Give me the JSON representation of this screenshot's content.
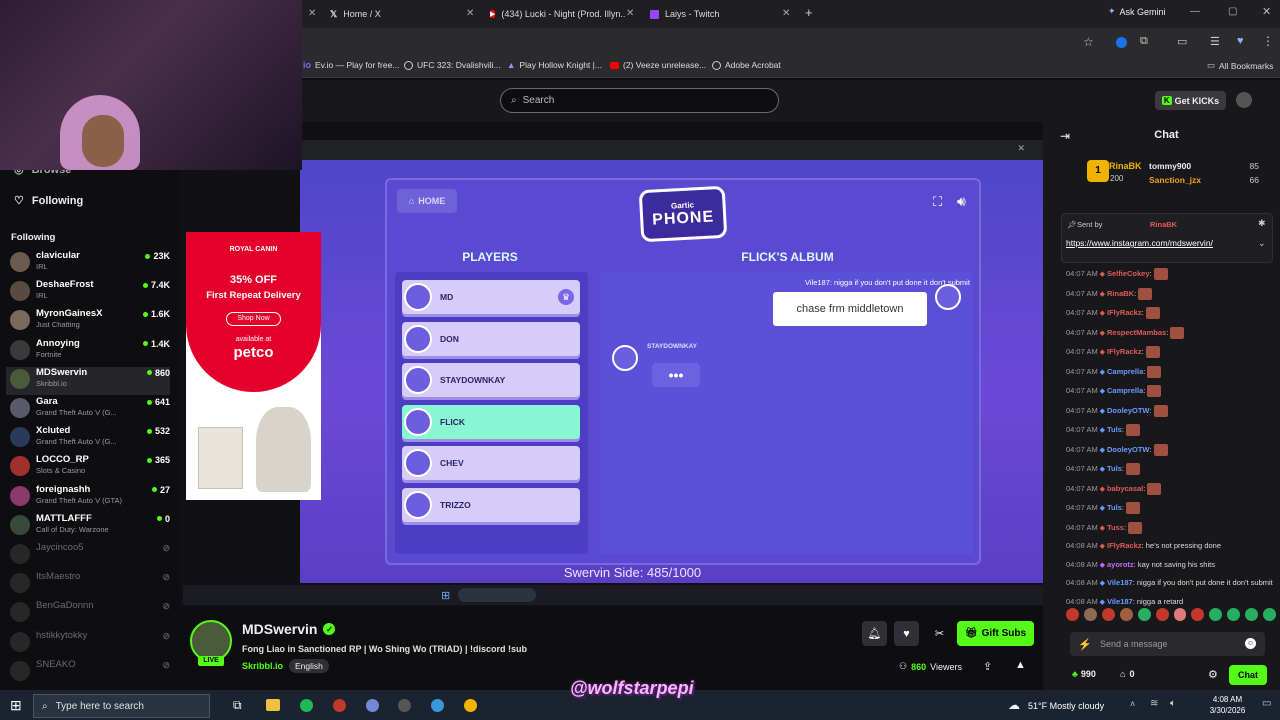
{
  "browser": {
    "tabs": [
      {
        "title": "Home / X",
        "icon": "x-logo-icon"
      },
      {
        "title": "(434) Lucki - Night (Prod. Illyn...",
        "icon": "youtube-icon"
      },
      {
        "title": "Laiys - Twitch",
        "icon": "twitch-icon"
      }
    ],
    "new_tab": "+",
    "ask_gemini": "Ask Gemini",
    "bookmarks": [
      {
        "label": "Ev.io — Play for free...",
        "icon": "evio-icon"
      },
      {
        "label": "UFC 323: Dvalishvili...",
        "icon": "globe-icon"
      },
      {
        "label": "Play Hollow Knight |...",
        "icon": "game-icon"
      },
      {
        "label": "(2) Veeze unrelease...",
        "icon": "youtube-icon"
      },
      {
        "label": "Adobe Acrobat",
        "icon": "globe-icon"
      }
    ],
    "all_bookmarks": "All Bookmarks"
  },
  "site": {
    "search_placeholder": "Search",
    "get_kicks": "Get KICKs"
  },
  "sidebar": {
    "browse": "Browse",
    "following_nav": "Following",
    "following_header": "Following",
    "channels": [
      {
        "name": "clavicular",
        "category": "IRL",
        "viewers": "23K",
        "live": true,
        "color": "#6a5a50"
      },
      {
        "name": "DeshaeFrost",
        "category": "IRL",
        "viewers": "7.4K",
        "live": true,
        "color": "#5a4a44"
      },
      {
        "name": "MyronGainesX",
        "category": "Just Chatting",
        "viewers": "1.6K",
        "live": true,
        "color": "#7a6a5a"
      },
      {
        "name": "Annoying",
        "category": "Fortnite",
        "viewers": "1.4K",
        "live": true,
        "color": "#3a3a3a"
      },
      {
        "name": "MDSwervin",
        "category": "Skribbl.io",
        "viewers": "860",
        "live": true,
        "color": "#4a5a3a"
      },
      {
        "name": "Gara",
        "category": "Grand Theft Auto V (G...",
        "viewers": "641",
        "live": true,
        "color": "#5a5a6a"
      },
      {
        "name": "Xcluted",
        "category": "Grand Theft Auto V (G...",
        "viewers": "532",
        "live": true,
        "color": "#2a3a5a"
      },
      {
        "name": "LOCCO_RP",
        "category": "Slots & Casino",
        "viewers": "365",
        "live": true,
        "color": "#a03030"
      },
      {
        "name": "foreignashh",
        "category": "Grand Theft Auto V (GTA)",
        "viewers": "27",
        "live": true,
        "color": "#8a3a6a"
      },
      {
        "name": "MATTLAFFF",
        "category": "Call of Duty: Warzone",
        "viewers": "0",
        "live": true,
        "color": "#3a4a3a"
      },
      {
        "name": "Jaycincoo5",
        "category": "",
        "viewers": "",
        "live": false,
        "color": "#555"
      },
      {
        "name": "ItsMaestro",
        "category": "",
        "viewers": "",
        "live": false,
        "color": "#555"
      },
      {
        "name": "BenGaDonnn",
        "category": "",
        "viewers": "",
        "live": false,
        "color": "#555"
      },
      {
        "name": "hstikkytokky",
        "category": "",
        "viewers": "",
        "live": false,
        "color": "#555"
      },
      {
        "name": "SNEAKO",
        "category": "",
        "viewers": "",
        "live": false,
        "color": "#555"
      }
    ]
  },
  "game": {
    "home": "HOME",
    "logo_top": "Gartic",
    "logo_main": "PHONE",
    "players_title": "PLAYERS",
    "album_title": "FLICK'S ALBUM",
    "players": [
      {
        "name": "MD",
        "host": true,
        "active": false
      },
      {
        "name": "DON",
        "host": false,
        "active": false
      },
      {
        "name": "STAYDOWNKAY",
        "host": false,
        "active": false
      },
      {
        "name": "FLICK",
        "host": false,
        "active": true
      },
      {
        "name": "CHEV",
        "host": false,
        "active": false
      },
      {
        "name": "TRIZZO",
        "host": false,
        "active": false
      }
    ],
    "bubble_text": "chase frm middletown",
    "typing_user": "STAYDOWNKAY",
    "typing_dots": "•••",
    "overlay_message": "Vile187: nigga if you don't put done it don't submit",
    "side_count": "Swervin Side: 485/1000"
  },
  "ad": {
    "brand": "ROYAL CANIN",
    "offer": "35% OFF",
    "offer_sub": "First Repeat Delivery",
    "cta": "Shop Now",
    "available": "available at",
    "retailer": "petco"
  },
  "stream": {
    "streamer": "MDSwervin",
    "title": "Fong Liao in Sanctioned RP | Wo Shing Wo (TRIAD) | !discord !sub",
    "category": "Skribbl.io",
    "language": "English",
    "live_label": "LIVE",
    "viewers": "860",
    "viewers_label": "Viewers",
    "gift_subs": "Gift Subs"
  },
  "chat": {
    "title": "Chat",
    "leaderboard": [
      {
        "rank": "1",
        "name": "RinaBK",
        "points": "200"
      },
      {
        "name": "tommy900",
        "points": "85"
      },
      {
        "name": "Sanction_jzx",
        "points": "66"
      }
    ],
    "pinned_by_label": "Sent by",
    "pinned_by": "RinaBK",
    "pinned_link": "https://www.instagram.com/mdswervin/",
    "messages": [
      {
        "time": "04:07 AM",
        "user": "SelfieCokey",
        "text": "",
        "color": "#e05a5a"
      },
      {
        "time": "04:07 AM",
        "user": "RinaBK",
        "text": "",
        "color": "#e05a5a"
      },
      {
        "time": "04:07 AM",
        "user": "IFlyRackz",
        "text": "",
        "color": "#e05a5a"
      },
      {
        "time": "04:07 AM",
        "user": "RespectMambas",
        "text": "",
        "color": "#e05a5a"
      },
      {
        "time": "04:07 AM",
        "user": "IFlyRackz",
        "text": "",
        "color": "#e05a5a"
      },
      {
        "time": "04:07 AM",
        "user": "Camprella",
        "text": "",
        "color": "#6a9aff"
      },
      {
        "time": "04:07 AM",
        "user": "Camprella",
        "text": "",
        "color": "#6a9aff"
      },
      {
        "time": "04:07 AM",
        "user": "DooleyOTW",
        "text": "",
        "color": "#6a9aff"
      },
      {
        "time": "04:07 AM",
        "user": "Tuls",
        "text": "",
        "color": "#6a9aff"
      },
      {
        "time": "04:07 AM",
        "user": "DooleyOTW",
        "text": "",
        "color": "#6a9aff"
      },
      {
        "time": "04:07 AM",
        "user": "Tuls",
        "text": "",
        "color": "#6a9aff"
      },
      {
        "time": "04:07 AM",
        "user": "babycasal",
        "text": "",
        "color": "#e05a5a"
      },
      {
        "time": "04:07 AM",
        "user": "Tuls",
        "text": "",
        "color": "#6a9aff"
      },
      {
        "time": "04:07 AM",
        "user": "Tuss",
        "text": "",
        "color": "#e05a5a"
      },
      {
        "time": "04:08 AM",
        "user": "IFlyRackz",
        "text": "he's not pressing done",
        "color": "#e05a5a"
      },
      {
        "time": "04:08 AM",
        "user": "ayorotz",
        "text": "kay not saving his shits",
        "color": "#c06aff"
      },
      {
        "time": "04:08 AM",
        "user": "Vile187",
        "text": "nigga if you don't put done it don't submit",
        "color": "#6a9aff"
      },
      {
        "time": "04:08 AM",
        "user": "Vile187",
        "text": "nigga a retard",
        "color": "#6a9aff"
      }
    ],
    "input_placeholder": "Send a message",
    "points": "990",
    "other_count": "0",
    "chat_button": "Chat"
  },
  "taskbar": {
    "search_placeholder": "Type here to search",
    "weather": "51°F Mostly cloudy",
    "time": "4:08 AM",
    "date": "3/30/2026"
  },
  "watermark": "@wolfstarpepi"
}
